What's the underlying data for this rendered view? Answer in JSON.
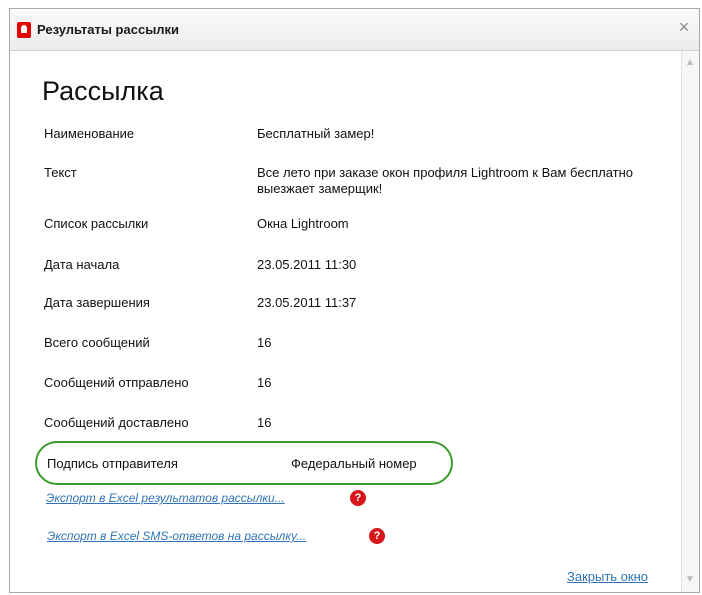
{
  "window": {
    "title": "Результаты рассылки",
    "close_symbol": "×"
  },
  "heading": "Рассылка",
  "fields": [
    {
      "label": "Наименование",
      "value": "Бесплатный замер!"
    },
    {
      "label": "Текст",
      "value": "Все лето при заказе окон профиля Lightroom к Вам бесплатно выезжает замерщик!"
    },
    {
      "label": "Список рассылки",
      "value": "Окна Lightroom"
    },
    {
      "label": "Дата начала",
      "value": "23.05.2011 11:30"
    },
    {
      "label": "Дата завершения",
      "value": "23.05.2011 11:37"
    },
    {
      "label": "Всего сообщений",
      "value": "16"
    },
    {
      "label": "Сообщений отправлено",
      "value": "16"
    },
    {
      "label": "Сообщений доставлено",
      "value": "16"
    }
  ],
  "signature": {
    "label": "Подпись отправителя",
    "value": "Федеральный номер"
  },
  "links": {
    "export_results": "Экспорт в Excel результатов рассылки...",
    "export_sms": "Экспорт в Excel SMS-ответов на рассылку..."
  },
  "help_symbol": "?",
  "close_window": "Закрыть окно",
  "colors": {
    "brand": "#e60000",
    "highlight_ring": "#3a9a2d",
    "link": "#2f73b8"
  },
  "icons": [
    "logo-icon",
    "close-icon",
    "help-icon",
    "scroll-up-icon",
    "scroll-down-icon"
  ]
}
